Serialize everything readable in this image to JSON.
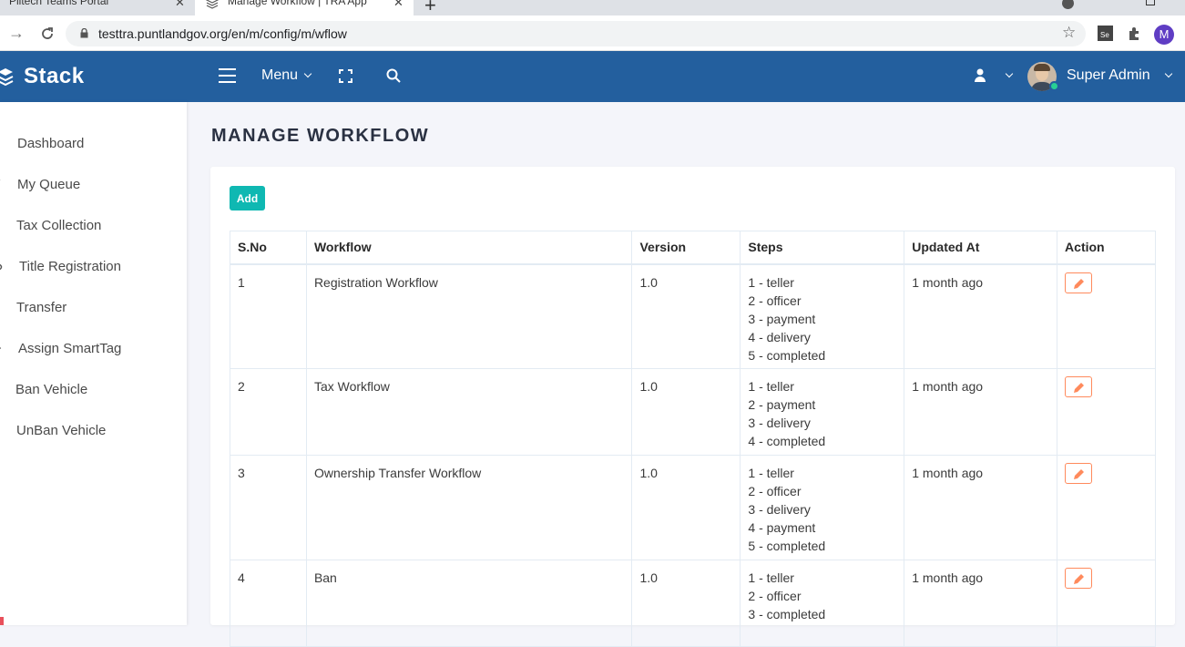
{
  "browser": {
    "tabs": [
      {
        "title": "Plitech Teams Portal"
      },
      {
        "title": "Manage Workflow | TRA App"
      }
    ],
    "url": "testtra.puntlandgov.org/en/m/config/m/wflow",
    "profile_initial": "M"
  },
  "header": {
    "brand": "Stack",
    "menu_label": "Menu",
    "username": "Super Admin",
    "accent_color": "#235f9e"
  },
  "sidebar": {
    "items": [
      {
        "label": "Dashboard"
      },
      {
        "label": "My Queue"
      },
      {
        "label": "Tax Collection"
      },
      {
        "label": "Title Registration"
      },
      {
        "label": "Transfer"
      },
      {
        "label": "Assign SmartTag"
      },
      {
        "label": "Ban Vehicle"
      },
      {
        "label": "UnBan Vehicle"
      }
    ]
  },
  "page": {
    "title": "MANAGE WORKFLOW",
    "add_label": "Add"
  },
  "table": {
    "headers": [
      "S.No",
      "Workflow",
      "Version",
      "Steps",
      "Updated At",
      "Action"
    ],
    "rows": [
      {
        "sno": "1",
        "workflow": "Registration Workflow",
        "version": "1.0",
        "steps": [
          "1 - teller",
          "2 - officer",
          "3 - payment",
          "4 - delivery",
          "5 - completed"
        ],
        "updated": "1 month ago"
      },
      {
        "sno": "2",
        "workflow": "Tax Workflow",
        "version": "1.0",
        "steps": [
          "1 - teller",
          "2 - payment",
          "3 - delivery",
          "4 - completed"
        ],
        "updated": "1 month ago"
      },
      {
        "sno": "3",
        "workflow": "Ownership Transfer Workflow",
        "version": "1.0",
        "steps": [
          "1 - teller",
          "2 - officer",
          "3 - delivery",
          "4 - payment",
          "5 - completed"
        ],
        "updated": "1 month ago"
      },
      {
        "sno": "4",
        "workflow": "Ban",
        "version": "1.0",
        "steps": [
          "1 - teller",
          "2 - officer",
          "3 - completed"
        ],
        "updated": "1 month ago"
      }
    ]
  }
}
